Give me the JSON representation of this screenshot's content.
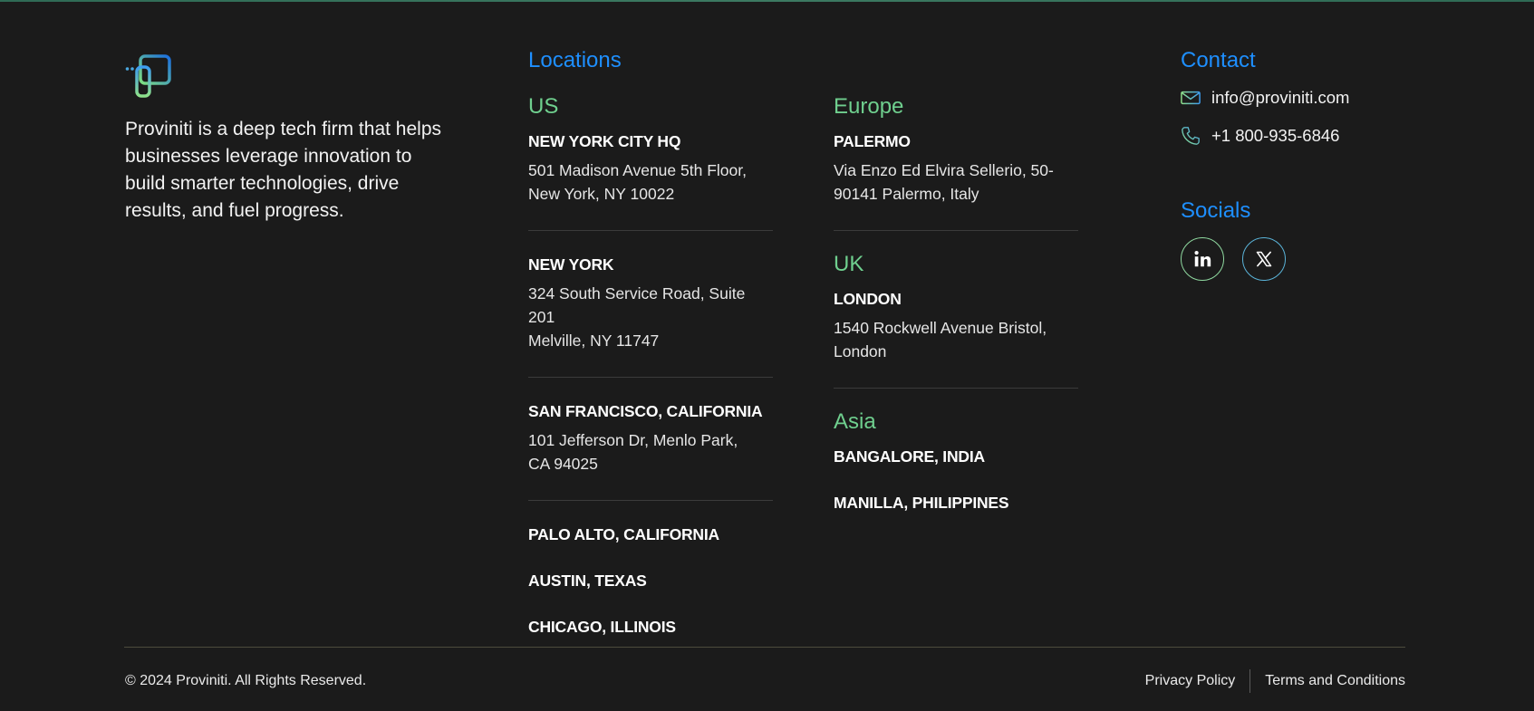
{
  "brand": {
    "name": "Proviniti",
    "logo_icon": "proviniti-logo-icon",
    "description": "Proviniti is a deep tech firm that helps businesses leverage innovation to build smarter technologies, drive results, and fuel progress.",
    "colors": {
      "background": "#1b1b1b",
      "accent_blue": "#1e8fff",
      "accent_green": "#6fcf8e"
    }
  },
  "locations": {
    "title": "Locations",
    "us": {
      "title": "US",
      "offices": [
        {
          "name": "NEW YORK CITY HQ",
          "addr1": "501 Madison Avenue 5th Floor,",
          "addr2": "New York, NY 10022"
        },
        {
          "name": "NEW YORK",
          "addr1": "324 South Service Road, Suite 201",
          "addr2": "Melville, NY 11747"
        },
        {
          "name": "SAN FRANCISCO, CALIFORNIA",
          "addr1": "101 Jefferson Dr, Menlo Park,",
          "addr2": "CA 94025"
        },
        {
          "name": "PALO ALTO, CALIFORNIA"
        },
        {
          "name": "AUSTIN, TEXAS"
        },
        {
          "name": "CHICAGO, ILLINOIS"
        }
      ]
    },
    "europe": {
      "title": "Europe",
      "offices": [
        {
          "name": "PALERMO",
          "addr1": "Via Enzo Ed Elvira Sellerio, 50-",
          "addr2": "90141 Palermo, Italy"
        }
      ]
    },
    "uk": {
      "title": "UK",
      "offices": [
        {
          "name": "LONDON",
          "addr1": "1540 Rockwell Avenue Bristol,",
          "addr2": "London"
        }
      ]
    },
    "asia": {
      "title": "Asia",
      "offices": [
        {
          "name": "BANGALORE, INDIA"
        },
        {
          "name": "MANILLA, PHILIPPINES"
        }
      ]
    }
  },
  "contact": {
    "title": "Contact",
    "email": "info@proviniti.com",
    "email_icon": "mail-icon",
    "phone": "+1 800-935-6846",
    "phone_icon": "phone-icon"
  },
  "socials": {
    "title": "Socials",
    "items": [
      {
        "name": "linkedin",
        "icon": "linkedin-icon"
      },
      {
        "name": "x",
        "icon": "x-icon"
      }
    ]
  },
  "footer": {
    "copyright": "© 2024 Proviniti. All Rights Reserved.",
    "privacy": "Privacy Policy",
    "terms": "Terms and Conditions"
  }
}
